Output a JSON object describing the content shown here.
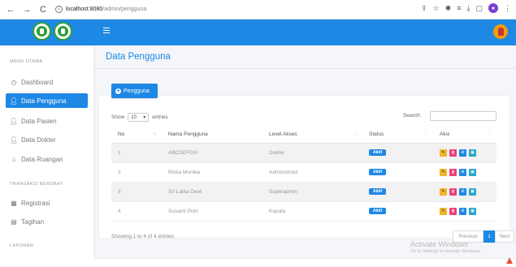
{
  "browser": {
    "back": "←",
    "forward": "→",
    "reload": "C",
    "url_host": "localhost:8080",
    "url_path": "/admin/pengguna",
    "profile_initial": "●"
  },
  "sidebar": {
    "header_main": "MENU UTAMA",
    "header_transaksi": "TRANSAKSI BEROBAT",
    "header_laporan": "LAPORAN",
    "items": [
      {
        "label": "Dashboard",
        "icon": "dashboard-icon"
      },
      {
        "label": "Data Pengguna",
        "icon": "user-icon"
      },
      {
        "label": "Data Pasien",
        "icon": "user-icon"
      },
      {
        "label": "Data Dokter",
        "icon": "user-icon"
      },
      {
        "label": "Data Ruangan",
        "icon": "home-icon"
      },
      {
        "label": "Registrasi",
        "icon": "calendar-icon"
      },
      {
        "label": "Tagihan",
        "icon": "invoice-icon"
      }
    ]
  },
  "page": {
    "title": "Data Pengguna",
    "add_button": "Pengguna"
  },
  "table_controls": {
    "show": "Show",
    "entries_value": "10",
    "entries": "entries",
    "search": "Search:"
  },
  "table": {
    "columns": [
      "No",
      "Nama Pengguna",
      "Level Akses",
      "Status",
      "Aksi"
    ],
    "rows": [
      {
        "no": "1",
        "nama": "ABCDEFGH",
        "level": "Dokter",
        "status": "Aktif"
      },
      {
        "no": "2",
        "nama": "Riska Monika",
        "level": "Administrasi",
        "status": "Aktif"
      },
      {
        "no": "3",
        "nama": "Sri Lalita Dewi",
        "level": "Superadmin",
        "status": "Aktif"
      },
      {
        "no": "4",
        "nama": "Susanti Putri",
        "level": "Kepala",
        "status": "Aktif"
      }
    ]
  },
  "footer": {
    "info": "Showing 1 to 4 of 4 entries",
    "prev": "Previous",
    "page": "1",
    "next": "Next"
  },
  "watermark": {
    "line1": "Activate Windows",
    "line2": "Go to Settings to activate Windows."
  },
  "colors": {
    "primary": "#1e88e5",
    "edit": "#f0b429",
    "delete": "#ec407a",
    "view": "#26a6c9"
  }
}
